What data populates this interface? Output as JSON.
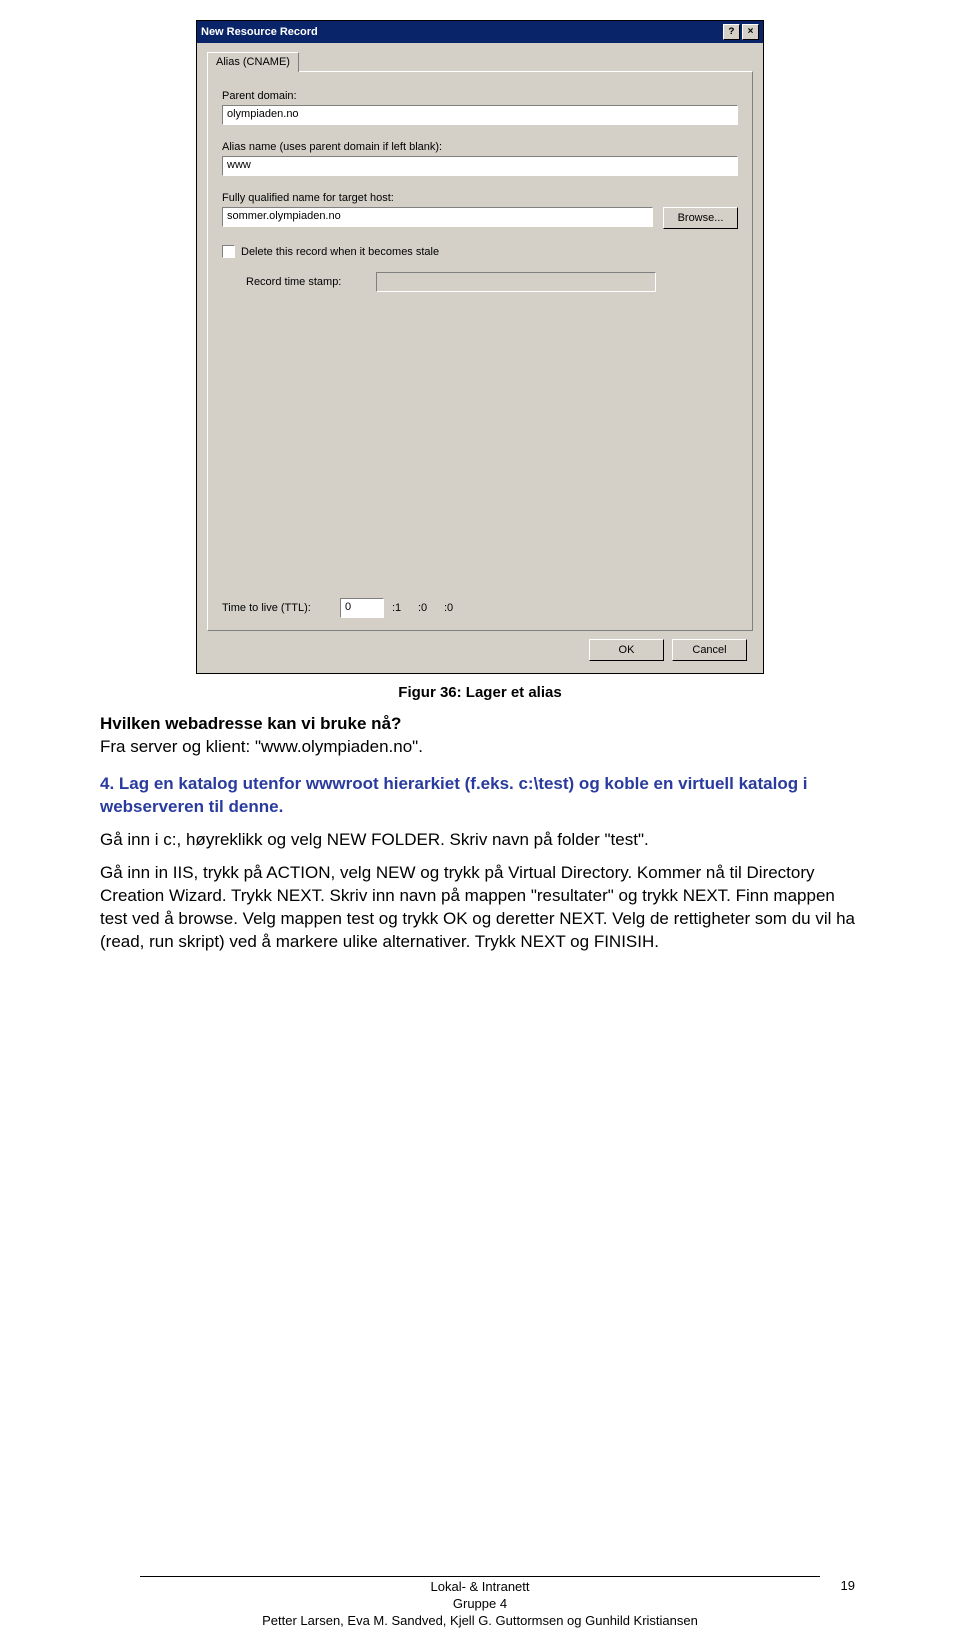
{
  "dialog": {
    "title": "New Resource Record",
    "help_btn": "?",
    "close_btn": "×",
    "tab_label": "Alias (CNAME)",
    "parent_domain_label": "Parent domain:",
    "parent_domain_value": "olympiaden.no",
    "alias_name_label": "Alias name (uses parent domain if left blank):",
    "alias_name_value": "www",
    "target_label": "Fully qualified name for target host:",
    "target_value": "sommer.olympiaden.no",
    "browse_btn": "Browse...",
    "delete_checkbox_label": "Delete this record when it becomes stale",
    "record_ts_label": "Record time stamp:",
    "ttl_label": "Time to live (TTL):",
    "ttl_days": "0",
    "ttl_hours": ":1",
    "ttl_minutes": ":0",
    "ttl_seconds": ":0",
    "ok_btn": "OK",
    "cancel_btn": "Cancel"
  },
  "caption": "Figur 36: Lager et alias",
  "doc": {
    "q_line": "Hvilken webadresse kan vi bruke nå?",
    "a_line": "Fra server og klient: \"www.olympiaden.no\".",
    "step4_heading": "4. Lag en katalog utenfor wwwroot hierarkiet (f.eks. c:\\test) og koble en virtuell katalog i webserveren til denne.",
    "p1": "Gå inn i c:, høyreklikk og velg NEW FOLDER. Skriv navn på folder \"test\".",
    "p2": "Gå inn in IIS, trykk på ACTION, velg NEW og trykk på Virtual Directory. Kommer nå til Directory Creation Wizard. Trykk NEXT. Skriv inn navn på mappen \"resultater\" og trykk NEXT. Finn mappen test ved å browse. Velg mappen test og trykk OK og deretter NEXT. Velg de rettigheter som du vil ha (read, run skript) ved å markere ulike alternativer. Trykk NEXT og FINISIH."
  },
  "footer": {
    "l1": "Lokal- & Intranett",
    "l2": "Gruppe 4",
    "l3": "Petter Larsen, Eva M. Sandved, Kjell G. Guttormsen og Gunhild Kristiansen",
    "page_num": "19"
  }
}
